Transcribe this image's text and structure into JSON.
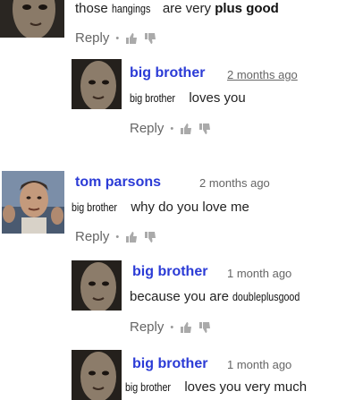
{
  "comments": [
    {
      "author": "",
      "time": "",
      "body_parts": [
        "those ",
        "hangings",
        " are very ",
        "plus good"
      ],
      "reply_label": "Reply"
    },
    {
      "author": "big brother",
      "time": "2 months ago",
      "body_parts": [
        "big brother",
        " loves you"
      ],
      "reply_label": "Reply"
    },
    {
      "author": "tom parsons",
      "time": "2 months ago",
      "body_parts": [
        "big brother",
        " why do you love me"
      ],
      "reply_label": "Reply"
    },
    {
      "author": "big brother",
      "time": "1 month ago",
      "body_parts": [
        "because you are ",
        "doubleplusgood"
      ],
      "reply_label": "Reply"
    },
    {
      "author": "big brother",
      "time": "1 month ago",
      "body_parts": [
        "big brother",
        " loves you very much"
      ],
      "reply_label": ""
    }
  ],
  "icons": {
    "like": "thumbs-up-icon",
    "dislike": "thumbs-down-icon"
  },
  "colors": {
    "author": "#2b3bd6",
    "background": "#ffffff"
  }
}
